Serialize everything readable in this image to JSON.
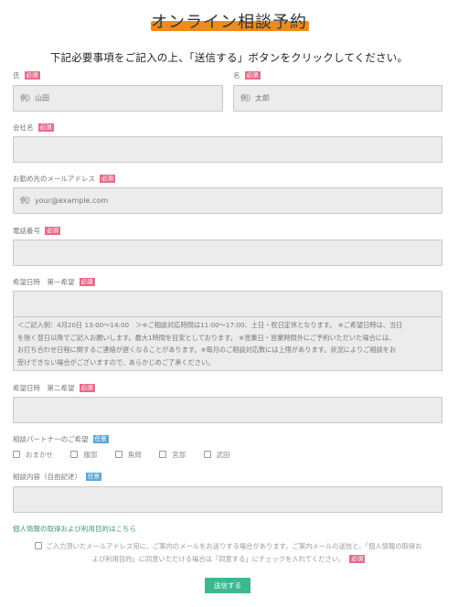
{
  "title": "オンライン相談予約",
  "lead": "下記必要事項をご記入の上、「送信する」ボタンをクリックしてください。",
  "badges": {
    "required": "必須",
    "optional": "任意"
  },
  "fields": {
    "last_name": {
      "label": "氏",
      "placeholder": "例）山田"
    },
    "first_name": {
      "label": "名",
      "placeholder": "例）太郎"
    },
    "company": {
      "label": "会社名",
      "placeholder": ""
    },
    "email": {
      "label": "お勤め先のメールアドレス",
      "placeholder": "例）your@example.com"
    },
    "phone": {
      "label": "電話番号",
      "placeholder": ""
    },
    "date1": {
      "label": "希望日時　第一希望",
      "placeholder": ""
    },
    "date2": {
      "label": "希望日時　第二希望",
      "placeholder": ""
    },
    "partner": {
      "label": "相談パートナーのご希望"
    },
    "content": {
      "label": "相談内容（自由記述）",
      "placeholder": ""
    }
  },
  "date_note": [
    "＜ご記入例：4月20日 13:00〜14:00　＞※ご相談対応時間は11:00〜17:00、土日・祝日定休となります。 ※ご希望日時は、当日",
    "を除く翌日以降でご記入お願いします。最大1時間を目安としております。 ※営業日・営業時間外にご予約いただいた場合には、",
    "お打ち合わせ日程に関するご連絡が遅くなることがあります。※毎月のご相談対応数には上限があります。状況によりご相談をお",
    "受けできない場合がございますので、あらかじめご了承ください。"
  ],
  "partner_options": [
    "おまかせ",
    "服部",
    "角岡",
    "宮部",
    "武田"
  ],
  "privacy_link": "個人情報の取得および利用目的はこちら",
  "consent": {
    "line1": "ご入力頂いたメールアドレス宛に、ご案内のメールをお送りする場合があります。ご案内メールの送信と、「個人情報の取得お",
    "line2": "よび利用目的」に同意いただける場合は「同意する」にチェックを入れてください。"
  },
  "submit_label": "送信する",
  "colors": {
    "title_highlight": "#f08a1a",
    "required_badge": "#e86b8a",
    "optional_badge": "#5aa8d8",
    "submit_button": "#3cb890",
    "privacy_link": "#3a9a6a"
  }
}
